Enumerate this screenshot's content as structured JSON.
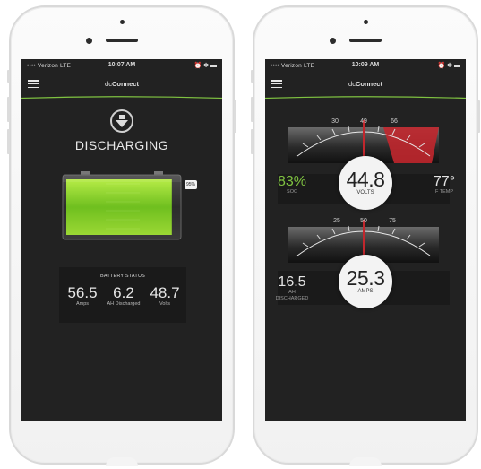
{
  "colors": {
    "accent": "#7fc241",
    "battery_green": "#8bd12c",
    "gauge_red": "#c1272d"
  },
  "left_phone": {
    "status_bar": {
      "carrier": "•••• Verizon  LTE",
      "time": "10:07 AM",
      "icons": "⏰ ✱ ▬"
    },
    "app": {
      "title_prefix": "dc",
      "title_bold": "Connect"
    },
    "state_title": "DISCHARGING",
    "battery": {
      "fill_percent": 95,
      "percent_label": "95%"
    },
    "battery_status": {
      "label": "BATTERY STATUS",
      "metrics": [
        {
          "value": "56.5",
          "label": "Amps"
        },
        {
          "value": "6.2",
          "label": "AH Discharged"
        },
        {
          "value": "48.7",
          "label": "Volts"
        }
      ]
    }
  },
  "right_phone": {
    "status_bar": {
      "carrier": "•••• Verizon  LTE",
      "time": "10:09 AM",
      "icons": "⏰ ✱ ▬"
    },
    "app": {
      "title_prefix": "dc",
      "title_bold": "Connect"
    },
    "volts_gauge": {
      "ticks": [
        "30",
        "49",
        "66"
      ],
      "value": "44.8",
      "unit": "VOLTS",
      "left": {
        "value": "83%",
        "label": "SOC"
      },
      "right": {
        "value": "77°",
        "label": "F TEMP"
      }
    },
    "amps_gauge": {
      "ticks": [
        "25",
        "50",
        "75"
      ],
      "value": "25.3",
      "unit": "AMPS",
      "left": {
        "value": "16.5",
        "label": "AH\nDISCHARGED"
      }
    }
  }
}
